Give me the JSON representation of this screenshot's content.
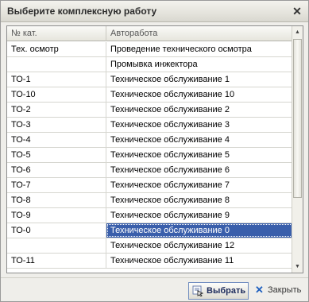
{
  "window": {
    "title": "Выберите комплексную работу"
  },
  "table": {
    "columns": [
      "№ кат.",
      "Авторабота"
    ],
    "rows": [
      {
        "cat": "Тех. осмотр",
        "work": "Проведение технического осмотра"
      },
      {
        "cat": "",
        "work": "Промывка инжектора"
      },
      {
        "cat": "ТО-1",
        "work": "Техническое обслуживание 1"
      },
      {
        "cat": "ТО-10",
        "work": "Техническое обслуживание 10"
      },
      {
        "cat": "ТО-2",
        "work": "Техническое обслуживание 2"
      },
      {
        "cat": "ТО-3",
        "work": "Техническое обслуживание 3"
      },
      {
        "cat": "ТО-4",
        "work": "Техническое обслуживание 4"
      },
      {
        "cat": "ТО-5",
        "work": "Техническое обслуживание 5"
      },
      {
        "cat": "ТО-6",
        "work": "Техническое обслуживание 6"
      },
      {
        "cat": "ТО-7",
        "work": "Техническое обслуживание 7"
      },
      {
        "cat": "ТО-8",
        "work": "Техническое обслуживание 8"
      },
      {
        "cat": "ТО-9",
        "work": "Техническое обслуживание 9"
      },
      {
        "cat": "ТО-0",
        "work": "Техническое обслуживание 0"
      },
      {
        "cat": "",
        "work": "Техническое обслуживание 12"
      },
      {
        "cat": "ТО-11",
        "work": "Техническое обслуживание 11"
      }
    ],
    "selected_index": 12
  },
  "footer": {
    "select_label": "Выбрать",
    "close_label": "Закрыть"
  },
  "colors": {
    "selection": "#3a5fab",
    "window_bg": "#efeeea"
  }
}
